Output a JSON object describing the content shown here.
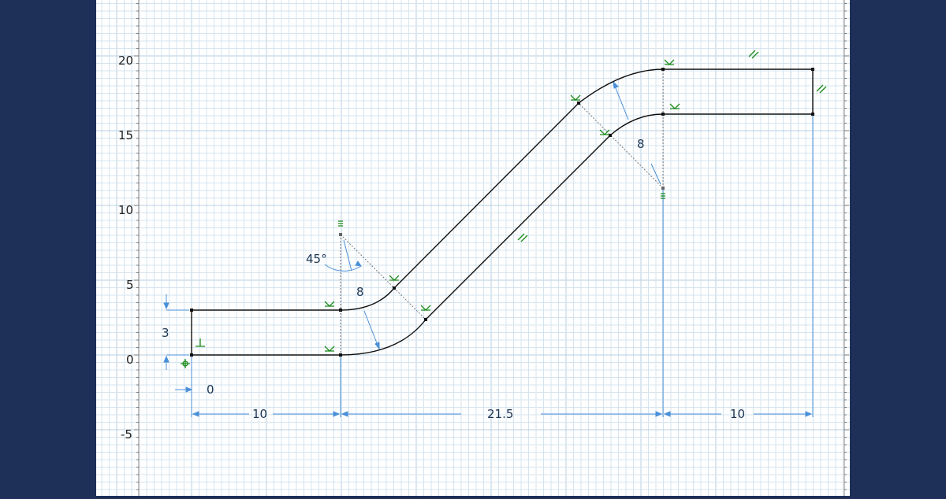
{
  "colors": {
    "side_panel": "#1e3058",
    "canvas": "#ffffff",
    "grid_minor": "#d6e4ef",
    "grid_major": "#b9cfe0",
    "geometry": "#111111",
    "construction": "#777777",
    "dimension": "#4a90d9",
    "dimension_text": "#1b3553",
    "constraint": "#1a8a1a",
    "axis_text": "#222222"
  },
  "axis": {
    "y_tick_labels": [
      "20",
      "15",
      "10",
      "5",
      "0",
      "-5"
    ]
  },
  "dimensions": {
    "left_length": "10",
    "middle_length": "21.5",
    "right_length": "10",
    "height": "3",
    "origin_offset": "0",
    "lower_radius": "8",
    "upper_radius": "8",
    "angle": "45°"
  },
  "constraint_icons": {
    "tangent": "tangent-icon",
    "parallel": "parallel-icon",
    "perpendicular": "perpendicular-icon",
    "fixed": "fixed-icon",
    "coincident": "coincident-icon"
  }
}
